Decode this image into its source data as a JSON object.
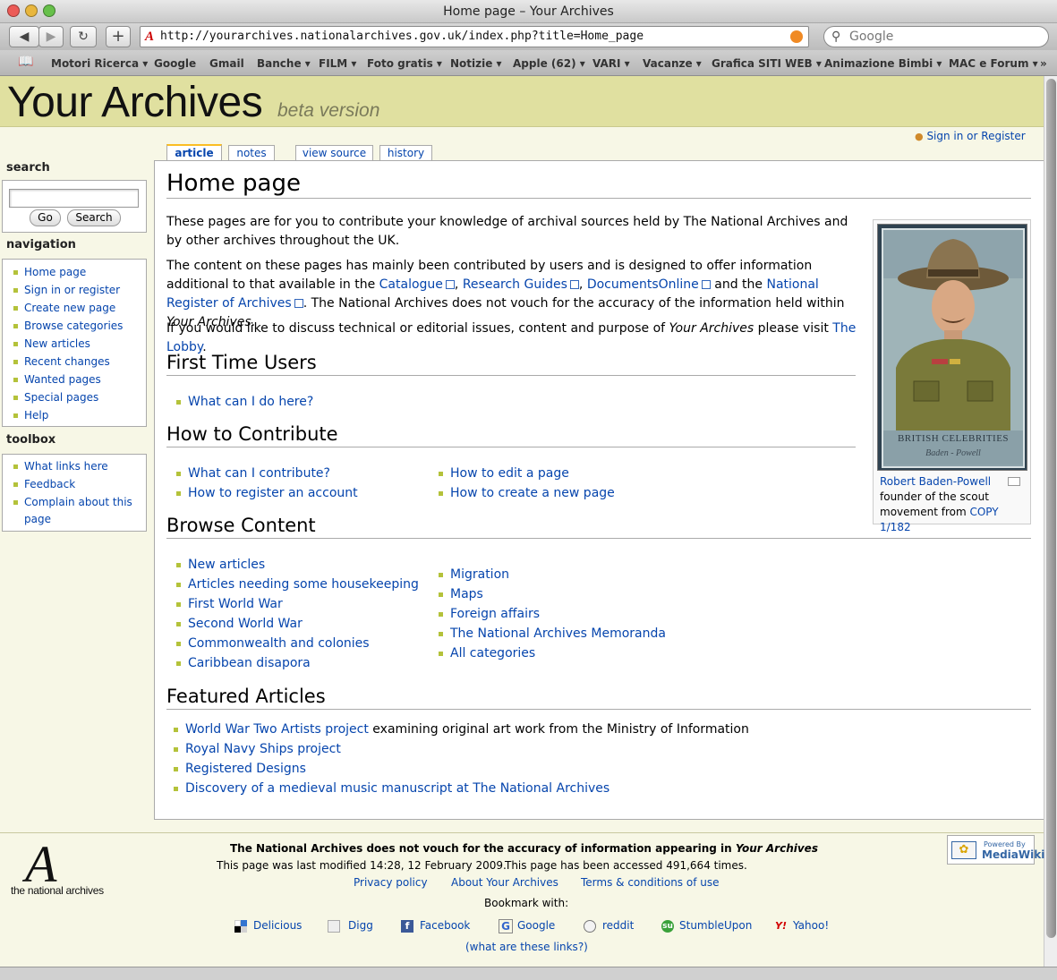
{
  "browser": {
    "window_title": "Home page – Your Archives",
    "url": "http://yourarchives.nationalarchives.gov.uk/index.php?title=Home_page",
    "search_placeholder": "Google",
    "bookmarks": [
      "Motori Ricerca ▾",
      "Google",
      "Gmail",
      "Banche ▾",
      "FILM ▾",
      "Foto gratis ▾",
      "Notizie ▾",
      "Apple (62) ▾",
      "VARI ▾",
      "Vacanze ▾",
      "Grafica SITI WEB ▾",
      "Animazione Bimbi ▾",
      "MAC e Forum ▾"
    ]
  },
  "site": {
    "title": "Your Archives",
    "subtitle": "beta version",
    "signin": "Sign in or Register"
  },
  "tabs": [
    "article",
    "notes",
    "view source",
    "history"
  ],
  "sidebar": {
    "search_heading": "search",
    "go_label": "Go",
    "search_label": "Search",
    "navigation_heading": "navigation",
    "navigation": [
      "Home page",
      "Sign in or register",
      "Create new page",
      "Browse categories",
      "New articles",
      "Recent changes",
      "Wanted pages",
      "Special pages",
      "Help"
    ],
    "toolbox_heading": "toolbox",
    "toolbox": [
      "What links here",
      "Feedback",
      "Complain about this",
      "page"
    ]
  },
  "content": {
    "title": "Home page",
    "intro1": "These pages are for you to contribute your knowledge of archival sources held by The National Archives and by other archives throughout the UK.",
    "intro2_a": "The content on these pages has mainly been contributed by users and is designed to offer information additional to that available in the",
    "links_inline": [
      "Catalogue",
      "Research Guides",
      "DocumentsOnline",
      "National Register of Archives"
    ],
    "intro2_and": "and the",
    "intro2_b": ". The National Archives does not vouch for the accuracy of the information held within",
    "your_archives_italic": "Your Archives",
    "intro3_a": "If you would like to discuss technical or editorial issues, content and purpose of",
    "intro3_b": "please visit",
    "lobby": "The Lobby",
    "first_time_heading": "First Time Users",
    "first_time_links": [
      "What can I do here?"
    ],
    "contribute_heading": "How to Contribute",
    "contribute_left": [
      "What can I contribute?",
      "How to register an account"
    ],
    "contribute_right": [
      "How to edit a page",
      "How to create a new page"
    ],
    "browse_heading": "Browse Content",
    "browse_left": [
      "New articles",
      "Articles needing some housekeeping",
      "First World War",
      "Second World War",
      "Commonwealth and colonies",
      "Caribbean disapora"
    ],
    "browse_right": [
      "Migration",
      "Maps",
      "Foreign affairs",
      "The National Archives Memoranda",
      "All categories"
    ],
    "featured_heading": "Featured Articles",
    "featured": [
      {
        "link": "World War Two Artists project",
        "text": " examining original art work from the Ministry of Information"
      },
      {
        "link": "Royal Navy Ships project",
        "text": ""
      },
      {
        "link": "Registered Designs",
        "text": ""
      },
      {
        "link": "Discovery of a medieval music manuscript at The National Archives",
        "text": ""
      }
    ]
  },
  "thumb": {
    "card_line1": "BRITISH CELEBRITIES",
    "card_line2": "Baden - Powell",
    "caption_link": "Robert Baden-Powell",
    "caption_text": "founder of the scout movement from",
    "caption_copy": "COPY 1/182"
  },
  "footer": {
    "logo_letter": "A",
    "logo_text": "the national archives",
    "disclaimer": "The National Archives does not vouch for the accuracy of information appearing in",
    "disclaimer_italic": "Your Archives",
    "modified": "This page was last modified 14:28, 12 February 2009.",
    "accessed": "This page has been accessed 491,664 times.",
    "links": [
      "Privacy policy",
      "About Your Archives",
      "Terms & conditions of use"
    ],
    "bookmark_with": "Bookmark with:",
    "social": [
      "Delicious",
      "Digg",
      "Facebook",
      "Google",
      "reddit",
      "StumbleUpon",
      "Yahoo!"
    ],
    "what_links": "(what are these links?)",
    "mediawiki_top": "Powered By",
    "mediawiki_bottom": "MediaWiki"
  }
}
